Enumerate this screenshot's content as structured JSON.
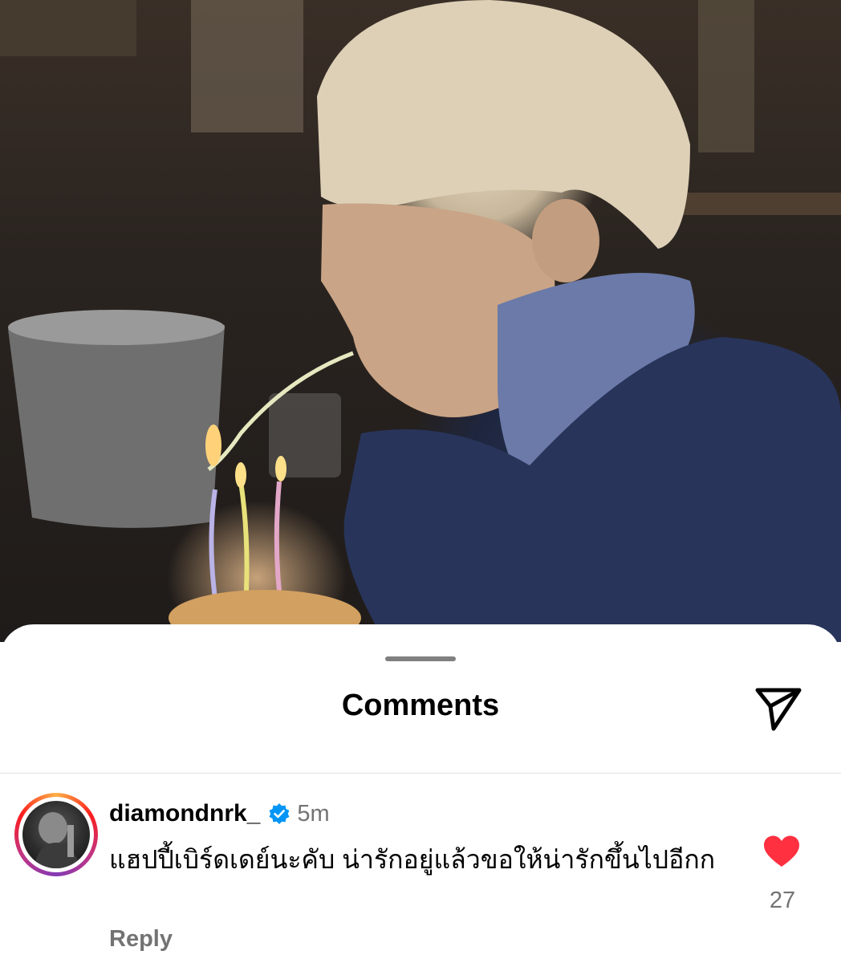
{
  "photo": {
    "description_icon": "photo-birthday-candles"
  },
  "sheet": {
    "title": "Comments",
    "share_icon": "paper-plane-icon"
  },
  "comments": [
    {
      "username": "diamondnrk_",
      "verified": true,
      "time": "5m",
      "text": "แฮปปี้เบิร์ดเดย์นะคับ น่ารักอยู่แล้วขอให้น่ารักขึ้นไปอีกก",
      "reply_label": "Reply",
      "like_count": "27",
      "liked": true
    }
  ],
  "colors": {
    "like_red": "#ff3040",
    "verified_blue": "#0095f6",
    "secondary_text": "#737373"
  }
}
